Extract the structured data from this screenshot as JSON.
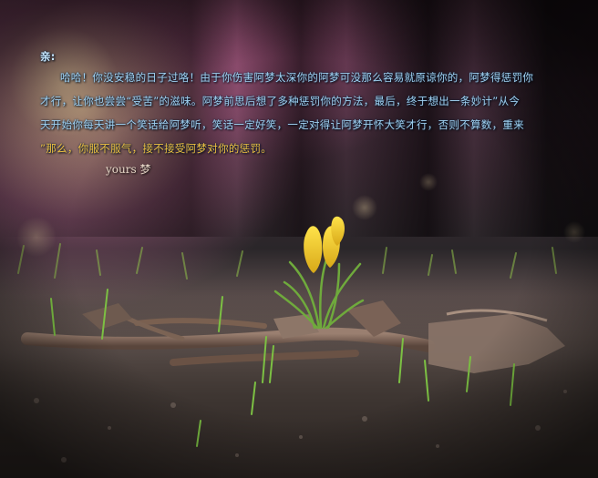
{
  "letter": {
    "salutation": "亲:",
    "line1": "哈哈！你没安稳的日子过咯！由于你伤害阿梦太深你的阿梦可没那么容易就原谅你的，阿梦得惩罚你",
    "line2": "才行，让你也尝尝“受苦”的滋味。阿梦前思后想了多种惩罚你的方法，最后，终于想出一条妙计”从今",
    "line3": "天开始你每天讲一个笑话给阿梦听，笑话一定好笑，一定对得让阿梦开怀大笑才行，否则不算数，重来",
    "line4_start": "”那么，",
    "line4_end": "你服不服气，接不接受阿梦对你的惩罚。",
    "signature": "yours 梦"
  },
  "colors": {
    "letter_text": "#9fd0f0",
    "highlight_text": "#f0c040",
    "flower": "#f2d02a",
    "leaves": "#6faa3c"
  }
}
